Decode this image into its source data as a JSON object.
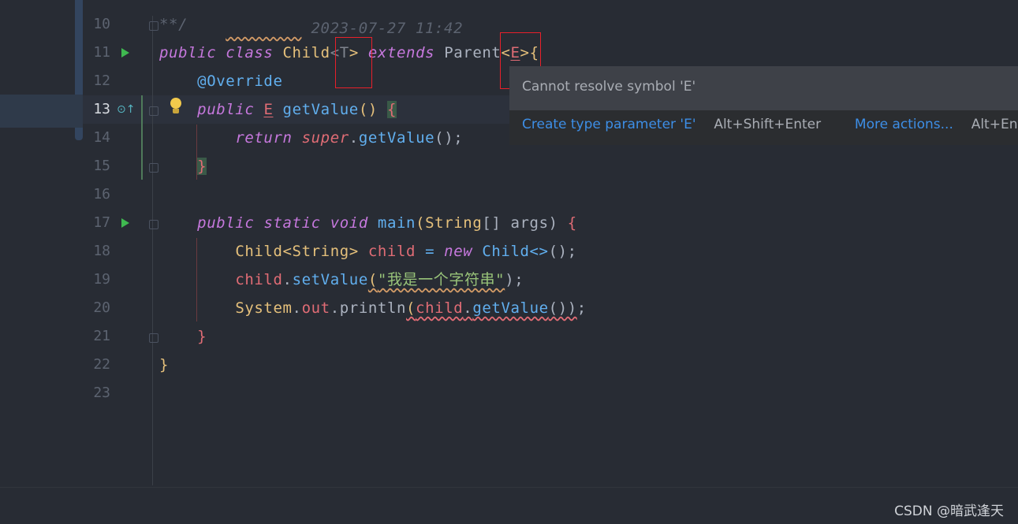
{
  "editor": {
    "lines": [
      {
        "num": "10",
        "seg": [
          {
            "t": "**/",
            "c": "comment-top"
          }
        ]
      },
      {
        "num": "11",
        "seg": [
          {
            "t": "public ",
            "c": "kw"
          },
          {
            "t": "class ",
            "c": "kw"
          },
          {
            "t": "Child",
            "c": "cls"
          },
          {
            "t": "<",
            "c": "gray"
          },
          {
            "t": "T",
            "c": "gray"
          },
          {
            "t": "> ",
            "c": "cls"
          },
          {
            "t": "extends ",
            "c": "kw"
          },
          {
            "t": "Parent",
            "c": ""
          },
          {
            "t": "<",
            "c": "cls"
          },
          {
            "t": "E",
            "c": "fld under"
          },
          {
            "t": ">",
            "c": "cls"
          },
          {
            "t": "{",
            "c": "cls"
          }
        ]
      },
      {
        "num": "12",
        "seg": [
          {
            "t": "    @Override",
            "c": "ann"
          }
        ]
      },
      {
        "num": "13",
        "seg": [
          {
            "t": "    "
          },
          {
            "t": "public ",
            "c": "kw"
          },
          {
            "t": "E",
            "c": "fld under"
          },
          {
            "t": " "
          },
          {
            "t": "getValue",
            "c": "fn"
          },
          {
            "t": "() ",
            "c": "cls"
          },
          {
            "t": "{",
            "c": "fld brace-hl"
          }
        ]
      },
      {
        "num": "14",
        "seg": [
          {
            "t": "        "
          },
          {
            "t": "return ",
            "c": "kw"
          },
          {
            "t": "super",
            "c": "kw fld"
          },
          {
            "t": "."
          },
          {
            "t": "getValue",
            "c": "fn"
          },
          {
            "t": "();",
            "c": ""
          }
        ]
      },
      {
        "num": "15",
        "seg": [
          {
            "t": "    "
          },
          {
            "t": "}",
            "c": "fld brace-hl"
          }
        ]
      },
      {
        "num": "16",
        "seg": []
      },
      {
        "num": "17",
        "seg": [
          {
            "t": "    "
          },
          {
            "t": "public ",
            "c": "kw"
          },
          {
            "t": "static ",
            "c": "kw"
          },
          {
            "t": "void ",
            "c": "kw"
          },
          {
            "t": "main",
            "c": "fn"
          },
          {
            "t": "(",
            "c": "cls"
          },
          {
            "t": "String",
            "c": "cls"
          },
          {
            "t": "[] args) ",
            "c": ""
          },
          {
            "t": "{",
            "c": "fld"
          }
        ]
      },
      {
        "num": "18",
        "seg": [
          {
            "t": "        "
          },
          {
            "t": "Child<String> ",
            "c": "cls"
          },
          {
            "t": "child ",
            "c": "fld"
          },
          {
            "t": "= ",
            "c": "fn"
          },
          {
            "t": "new ",
            "c": "kw"
          },
          {
            "t": "Child<>",
            "c": "fn"
          },
          {
            "t": "();",
            "c": ""
          }
        ]
      },
      {
        "num": "19",
        "seg": [
          {
            "t": "        "
          },
          {
            "t": "child",
            "c": "fld"
          },
          {
            "t": "."
          },
          {
            "t": "setValue",
            "c": "fn"
          },
          {
            "t": "(",
            "c": "cls sqy"
          },
          {
            "t": "\"我是一个字符串\"",
            "c": "str sqy"
          },
          {
            "t": ");",
            "c": ""
          }
        ]
      },
      {
        "num": "20",
        "seg": [
          {
            "t": "        "
          },
          {
            "t": "System",
            "c": "cls"
          },
          {
            "t": "."
          },
          {
            "t": "out",
            "c": "fld"
          },
          {
            "t": "."
          },
          {
            "t": "println",
            "c": ""
          },
          {
            "t": "(",
            "c": "cls sq"
          },
          {
            "t": "child",
            "c": "fld sq"
          },
          {
            "t": ".",
            "c": "sq"
          },
          {
            "t": "getValue",
            "c": "fn sq"
          },
          {
            "t": "())",
            "c": "sq"
          },
          {
            "t": ";",
            "c": ""
          }
        ]
      },
      {
        "num": "21",
        "seg": [
          {
            "t": "    "
          },
          {
            "t": "}",
            "c": "fld"
          }
        ]
      },
      {
        "num": "22",
        "seg": [
          {
            "t": "}",
            "c": "cls"
          }
        ]
      },
      {
        "num": "23",
        "seg": []
      }
    ]
  },
  "popup": {
    "message": "Cannot resolve symbol 'E'",
    "action_label": "Create type parameter 'E'",
    "action_shortcut": "Alt+Shift+Enter",
    "more_label": "More actions...",
    "more_shortcut": "Alt+Enter"
  },
  "watermark": "CSDN @暗武逢天",
  "colors": {
    "keyword": "#c678dd",
    "type": "#e5c07b",
    "method": "#61afef",
    "string": "#98c379",
    "error": "#e06c75",
    "link": "#3d8ee6"
  },
  "icons": [
    "run-icon",
    "fold-icon",
    "override-icon",
    "lightbulb-icon"
  ]
}
